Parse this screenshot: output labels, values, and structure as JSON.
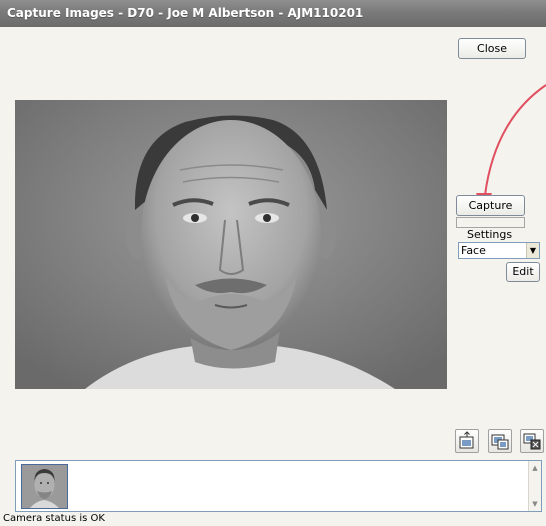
{
  "window": {
    "title": "Capture Images - D70 - Joe M Albertson - AJM110201"
  },
  "buttons": {
    "close": "Close",
    "capture": "Capture",
    "edit": "Edit"
  },
  "settings": {
    "label": "Settings",
    "selected": "Face"
  },
  "toolbar": {
    "icons": [
      "image-import-icon",
      "image-export-icon",
      "delete-image-icon"
    ]
  },
  "status": {
    "text": "Camera status is OK"
  },
  "annotation": {
    "arrow_color": "#e05060"
  }
}
